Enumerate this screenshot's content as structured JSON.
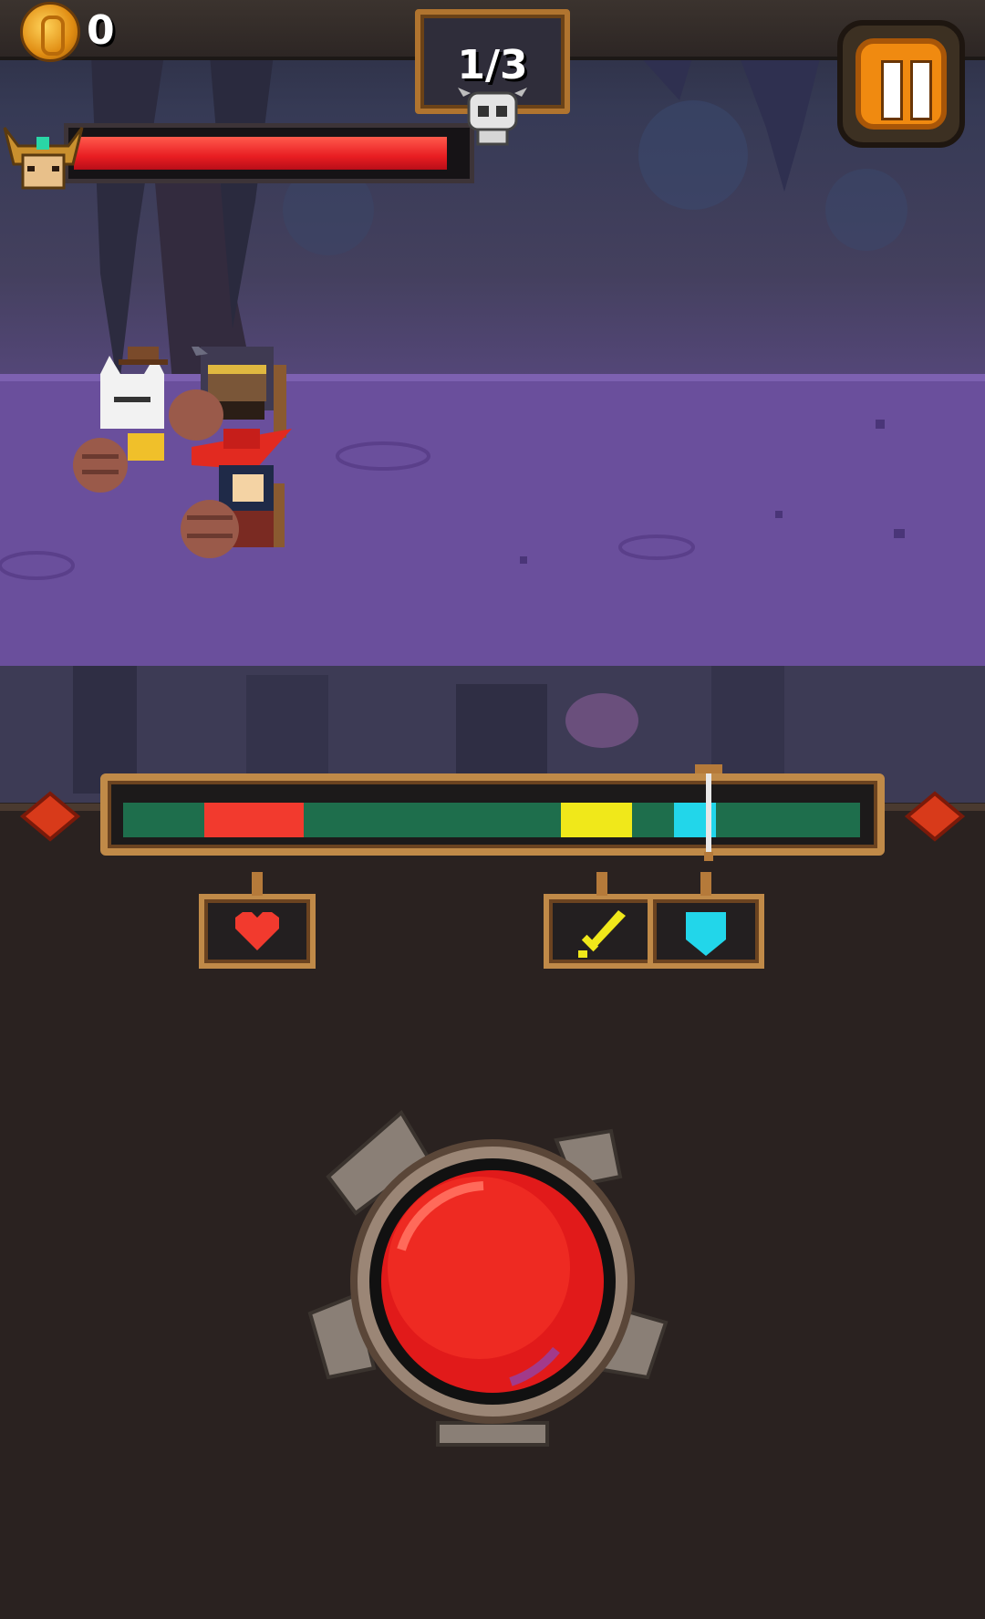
{
  "hud": {
    "coins": "0",
    "wave": "1/3",
    "boss_hp_fraction": 0.96
  },
  "timing_bar": {
    "zones": [
      {
        "type": "heart",
        "start": 0.11,
        "end": 0.245,
        "color": "#f23a2e"
      },
      {
        "type": "attack",
        "start": 0.594,
        "end": 0.69,
        "color": "#f0e81a"
      },
      {
        "type": "defense",
        "start": 0.747,
        "end": 0.804,
        "color": "#22d6ea"
      }
    ],
    "cursor_position": 0.789,
    "track_color": "#1e6e4c"
  },
  "action_slots": [
    {
      "name": "heart-icon",
      "color": "#f23a2e"
    },
    {
      "name": "sword-icon",
      "color": "#f0e81a"
    },
    {
      "name": "shield-icon",
      "color": "#22d6ea"
    }
  ],
  "colors": {
    "button_red": "#e11a1a",
    "frame_gold": "#c08a48",
    "pause_orange": "#f08a10"
  }
}
